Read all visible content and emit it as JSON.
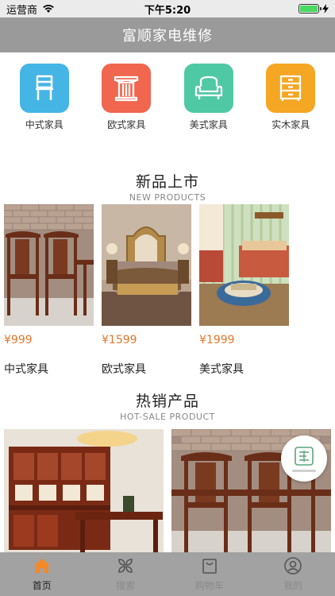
{
  "status_bar": {
    "carrier": "运营商",
    "time": "下午5:20",
    "battery_level": 1.0
  },
  "nav": {
    "title": "富顺家电维修"
  },
  "categories": [
    {
      "label": "中式家具",
      "icon": "chair-icon",
      "color": "#45b5e6"
    },
    {
      "label": "欧式家具",
      "icon": "column-icon",
      "color": "#f0664f"
    },
    {
      "label": "美式家具",
      "icon": "sofa-icon",
      "color": "#4fc9a3"
    },
    {
      "label": "实木家具",
      "icon": "cabinet-icon",
      "color": "#f5a623"
    }
  ],
  "new_section": {
    "title": "新品上市",
    "subtitle": "NEW PRODUCTS"
  },
  "new_products": [
    {
      "price": "¥999",
      "name": "中式家具"
    },
    {
      "price": "¥1599",
      "name": "欧式家具"
    },
    {
      "price": "¥1999",
      "name": "美式家具"
    }
  ],
  "hot_section": {
    "title": "热销产品",
    "subtitle": "HOT-SALE PRODUCT"
  },
  "tabs": [
    {
      "label": "首页",
      "icon": "home-icon",
      "active": true
    },
    {
      "label": "搜索",
      "icon": "grid-icon",
      "active": false
    },
    {
      "label": "购物车",
      "icon": "cart-icon",
      "active": false
    },
    {
      "label": "我的",
      "icon": "user-icon",
      "active": false
    }
  ],
  "colors": {
    "accent": "#e2772c",
    "nav_bg": "#9a9a9a",
    "tab_bg": "#a2a2a2"
  }
}
